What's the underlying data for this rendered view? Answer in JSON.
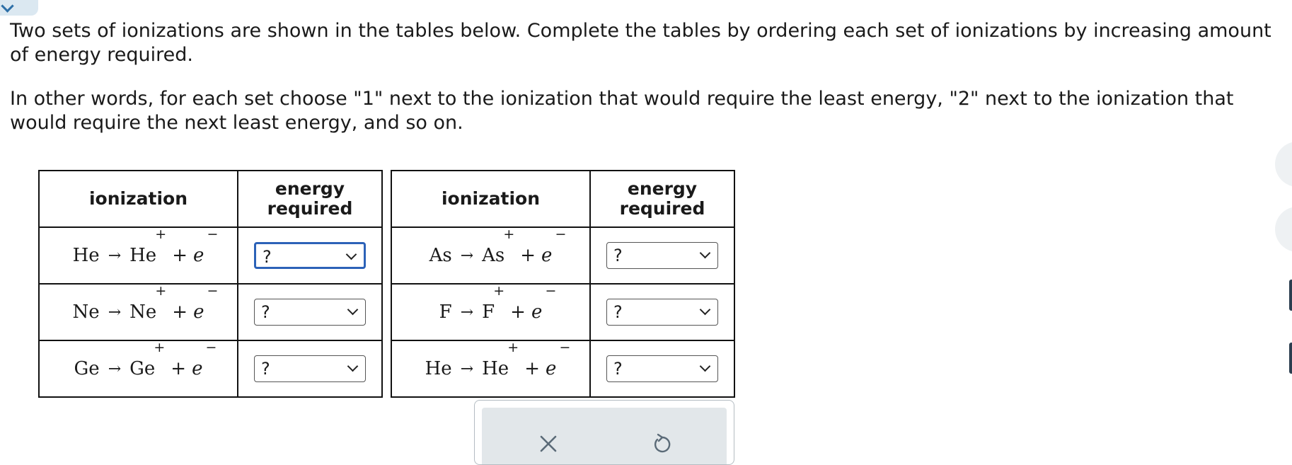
{
  "instructions": {
    "paragraph1": "Two sets of ionizations are shown in the tables below. Complete the tables by ordering each set of ionizations by increasing amount of energy required.",
    "paragraph2": "In other words, for each set choose \"1\" next to the ionization that would require the least energy, \"2\" next to the ionization that would require the next least energy, and so on."
  },
  "tables": [
    {
      "header_ionization": "ionization",
      "header_energy": "energy required",
      "rows": [
        {
          "reactant": "He",
          "product": "He",
          "charge": "+",
          "electron": "e",
          "electron_charge": "−",
          "selected": "?"
        },
        {
          "reactant": "Ne",
          "product": "Ne",
          "charge": "+",
          "electron": "e",
          "electron_charge": "−",
          "selected": "?"
        },
        {
          "reactant": "Ge",
          "product": "Ge",
          "charge": "+",
          "electron": "e",
          "electron_charge": "−",
          "selected": "?"
        }
      ]
    },
    {
      "header_ionization": "ionization",
      "header_energy": "energy required",
      "rows": [
        {
          "reactant": "As",
          "product": "As",
          "charge": "+",
          "electron": "e",
          "electron_charge": "−",
          "selected": "?"
        },
        {
          "reactant": "F",
          "product": "F",
          "charge": "+",
          "electron": "e",
          "electron_charge": "−",
          "selected": "?"
        },
        {
          "reactant": "He",
          "product": "He",
          "charge": "+",
          "electron": "e",
          "electron_charge": "−",
          "selected": "?"
        }
      ]
    }
  ],
  "symbols": {
    "arrow": "→",
    "plus": "+"
  },
  "toolbar": {
    "icons": [
      "close-icon",
      "undo-icon"
    ]
  },
  "colors": {
    "focus": "#2c62b8",
    "toolbar_bg": "#e2e7ea",
    "badge_bg": "#dbe8f1"
  }
}
